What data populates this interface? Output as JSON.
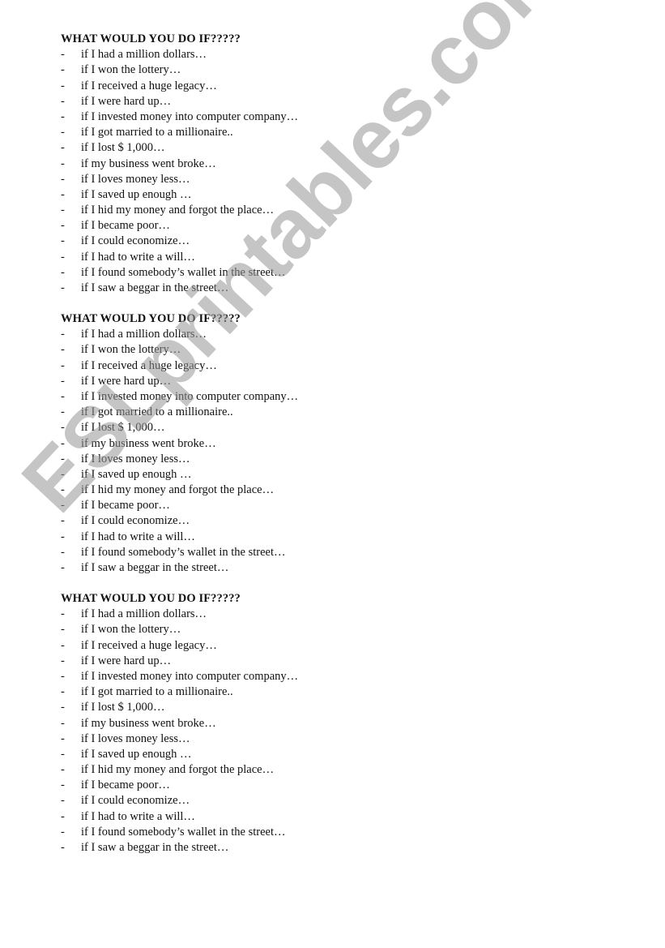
{
  "document": {
    "sections": [
      {
        "title": "WHAT WOULD YOU DO IF?????",
        "bullet": "-",
        "items": [
          "if I had a million dollars…",
          "if I won the lottery…",
          "if I received a huge legacy…",
          "if I were hard up…",
          "if I invested money into computer company…",
          "if I got married to a millionaire..",
          "if I lost $ 1,000…",
          "if my business went broke…",
          "if I loves money less…",
          "if I saved up enough …",
          "if I hid my money and forgot the place…",
          "if I became poor…",
          "if I could economize…",
          "if I had to write a will…",
          "if I found somebody’s wallet in the street…",
          "if I saw a beggar in the street…"
        ]
      },
      {
        "title": "WHAT WOULD YOU DO IF?????",
        "bullet": "-",
        "items": [
          "if I had a million dollars…",
          "if I won the lottery…",
          "if I received a huge legacy…",
          "if I were hard up…",
          "if I invested money into computer company…",
          "if I got married to a millionaire..",
          "if I lost $ 1,000…",
          "if my business went broke…",
          "if I loves money less…",
          "if I saved up enough …",
          "if I hid my money and forgot the place…",
          "if I became poor…",
          "if I could economize…",
          "if I had to write a will…",
          "if I found somebody’s wallet in the street…",
          "if I saw a beggar in the street…"
        ]
      },
      {
        "title": "WHAT WOULD YOU DO IF?????",
        "bullet": "-",
        "items": [
          "if I had a million dollars…",
          "if I won the lottery…",
          "if I received a huge legacy…",
          "if I were hard up…",
          "if I invested money into computer company…",
          "if I got married to a millionaire..",
          "if I lost $ 1,000…",
          "if my business went broke…",
          "if I loves money less…",
          "if I saved up enough …",
          "if I hid my money and forgot the place…",
          "if I became poor…",
          "if I could economize…",
          "if I had to write a will…",
          "if I found somebody’s wallet in the street…",
          "if I saw a beggar in the street…"
        ]
      }
    ]
  },
  "watermark": {
    "text": "ESLprintables.com",
    "color": "#969696"
  }
}
